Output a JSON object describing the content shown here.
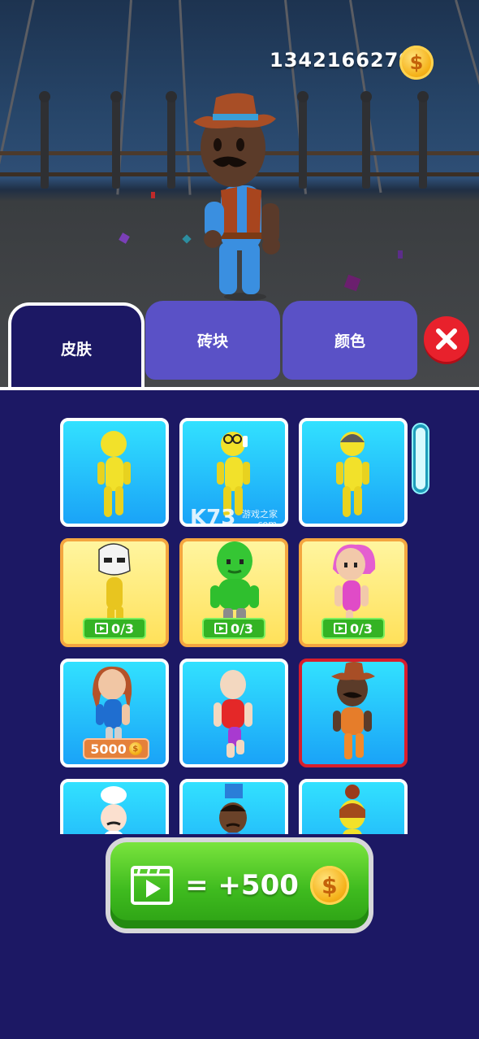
{
  "coins": {
    "amount": "1342166279",
    "coin_icon": "$"
  },
  "tabs": [
    {
      "label": "皮肤",
      "active": true
    },
    {
      "label": "砖块",
      "active": false
    },
    {
      "label": "颜色",
      "active": false
    }
  ],
  "grid": {
    "cards": [
      {
        "skin": "plain-yellow",
        "style": "blue"
      },
      {
        "skin": "yellow-glasses",
        "style": "blue"
      },
      {
        "skin": "yellow-cap",
        "style": "blue"
      },
      {
        "skin": "stormtrooper",
        "style": "yellow",
        "progress_label": "0/3",
        "progress": 0
      },
      {
        "skin": "green-orc",
        "style": "yellow",
        "progress_label": "0/3",
        "progress": 0
      },
      {
        "skin": "pink-hair-girl",
        "style": "yellow",
        "progress_label": "0/3",
        "progress": 0
      },
      {
        "skin": "redhead-girl",
        "style": "blue",
        "price": "5000"
      },
      {
        "skin": "bald-red-shirt",
        "style": "blue"
      },
      {
        "skin": "cowboy",
        "style": "blue",
        "selected": true
      },
      {
        "skin": "chef",
        "style": "blue"
      },
      {
        "skin": "top-hat",
        "style": "blue"
      },
      {
        "skin": "bun-hair",
        "style": "blue"
      }
    ]
  },
  "ad_button": {
    "label": "= +500"
  },
  "watermark": {
    "logo": "K73",
    "text": "游戏之家",
    "sub": ".com"
  },
  "colors": {
    "accent_tab": "#5a51c6",
    "panel": "#1c1864",
    "close": "#e8212c",
    "ad_green": "#3fbb1f"
  }
}
